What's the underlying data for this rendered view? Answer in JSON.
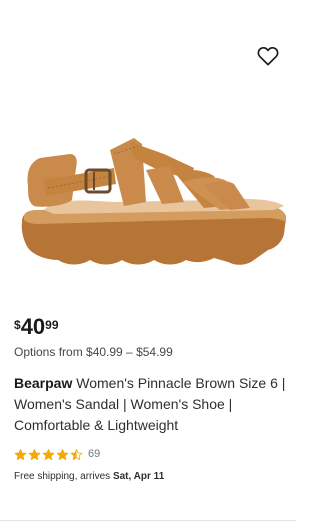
{
  "product": {
    "price": {
      "currency_symbol": "$",
      "dollars": "40",
      "cents": "99"
    },
    "options_text": "Options from $40.99 – $54.99",
    "brand": "Bearpaw",
    "name": "Women's Pinnacle Brown Size 6 | Women's Sandal | Women's Shoe | Comfortable & Lightweight",
    "rating": {
      "value": 4.5,
      "out_of": 5,
      "review_count": "69"
    },
    "shipping": {
      "prefix": "Free shipping, arrives",
      "date": "Sat, Apr 11"
    },
    "image_icon": "sandal-image",
    "favorite_icon": "heart-outline-icon"
  },
  "colors": {
    "star_filled": "#f2a900",
    "star_empty": "#c9cacc",
    "sandal_tan": "#c98a4b",
    "text_primary": "#2e2f32"
  }
}
